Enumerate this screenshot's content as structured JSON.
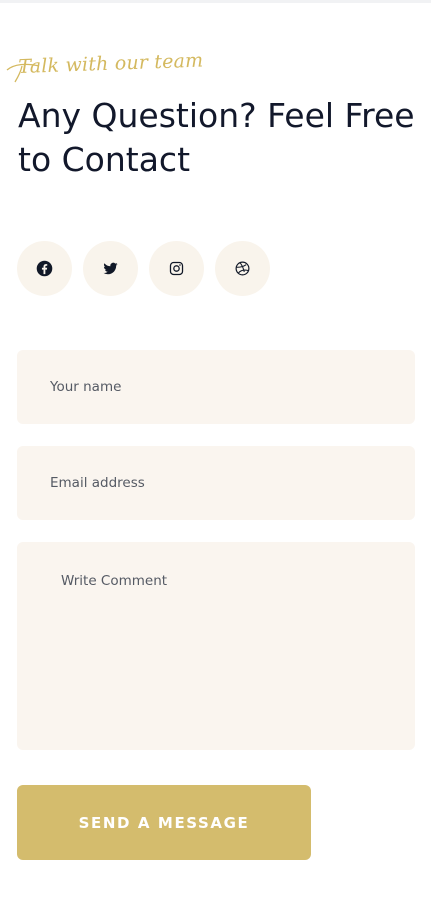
{
  "header": {
    "tagline": "Talk with our team",
    "title": "Any Question? Feel Free to Contact"
  },
  "socials": [
    {
      "icon": "facebook-icon"
    },
    {
      "icon": "twitter-icon"
    },
    {
      "icon": "instagram-icon"
    },
    {
      "icon": "dribbble-icon"
    }
  ],
  "form": {
    "name_placeholder": "Your name",
    "email_placeholder": "Email address",
    "comment_placeholder": "Write Comment",
    "submit_label": "SEND A MESSAGE"
  },
  "colors": {
    "accent": "#d4bc6d",
    "tagline": "#d4b95f",
    "field_background": "#faf5ef",
    "social_background": "#f9f4ec",
    "title": "#12182b"
  }
}
